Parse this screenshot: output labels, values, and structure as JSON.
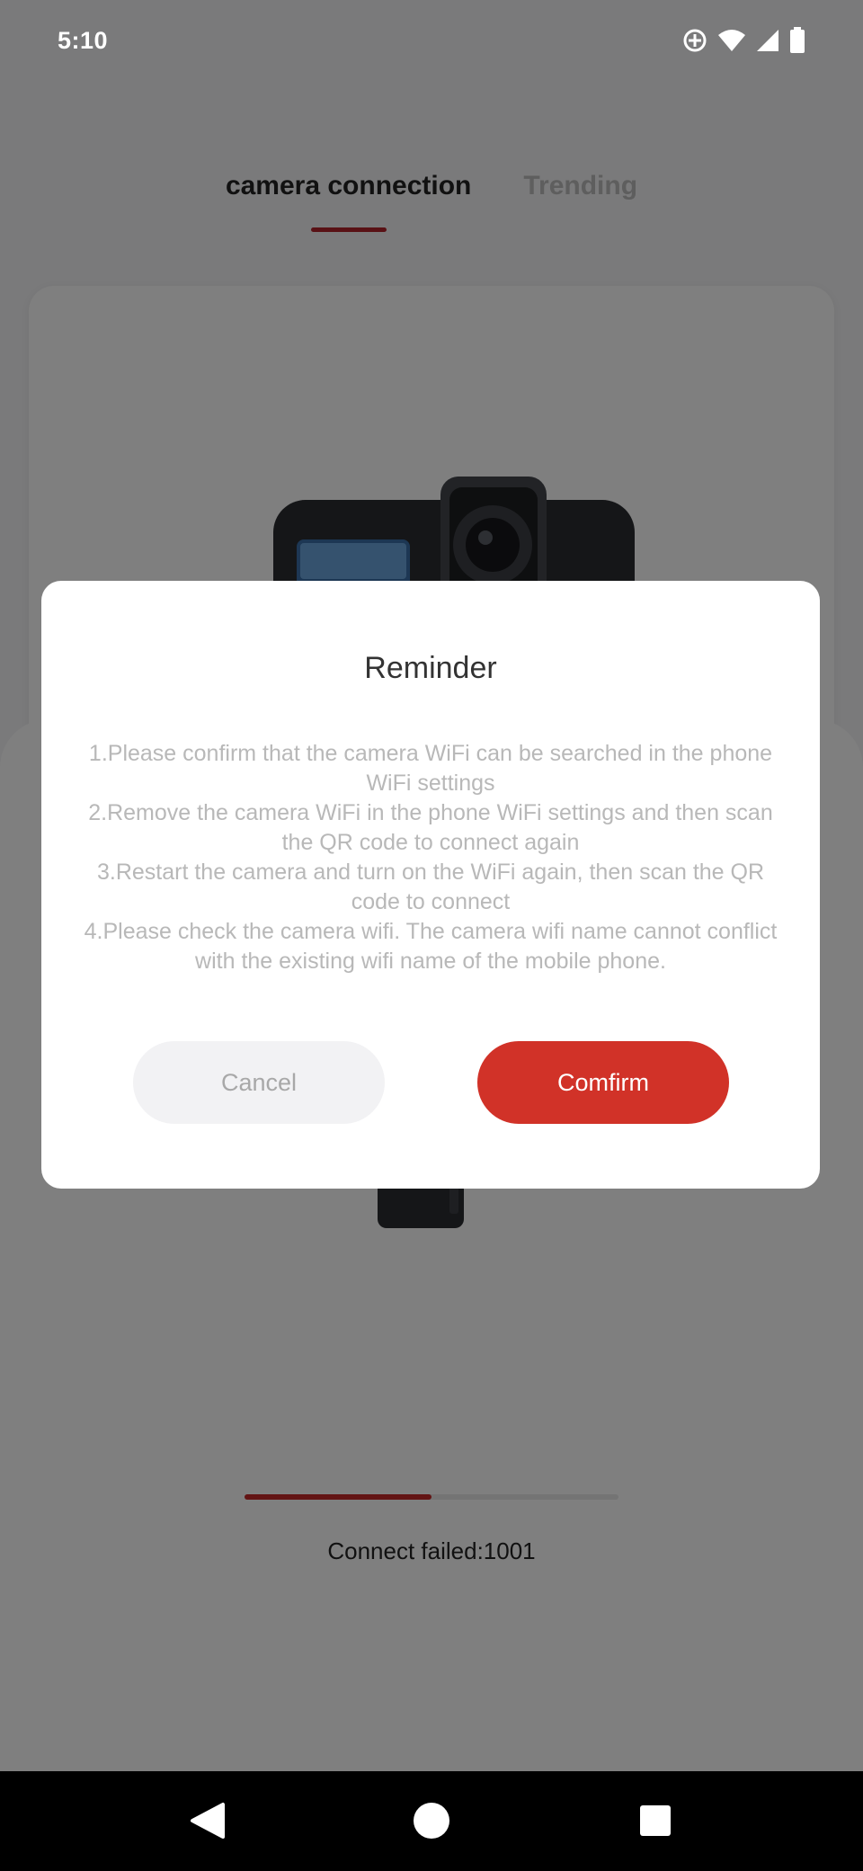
{
  "status_bar": {
    "time": "5:10",
    "icons": [
      "hotspot-icon",
      "wifi-icon",
      "signal-icon",
      "battery-icon"
    ]
  },
  "tabs": [
    {
      "label": "camera connection",
      "active": true
    },
    {
      "label": "Trending",
      "active": false
    }
  ],
  "progress": {
    "fraction": 0.5,
    "status_text": "Connect failed:1001"
  },
  "dialog": {
    "title": "Reminder",
    "lines": [
      "1.Please confirm that the camera WiFi can be searched in the phone WiFi settings",
      "2.Remove the camera WiFi in the phone WiFi settings and then scan the QR code to connect again",
      "3.Restart the camera and turn on the WiFi again, then scan the QR code to connect",
      "4.Please check the camera wifi. The camera wifi name cannot conflict with the existing wifi name of the mobile phone."
    ],
    "cancel_label": "Cancel",
    "confirm_label": "Comfirm"
  },
  "nav_bar": {
    "icons": [
      "back-icon",
      "home-icon",
      "recents-icon"
    ]
  },
  "colors": {
    "accent": "#d13228",
    "tab_indicator": "#b2222a",
    "progress": "#c62828"
  }
}
